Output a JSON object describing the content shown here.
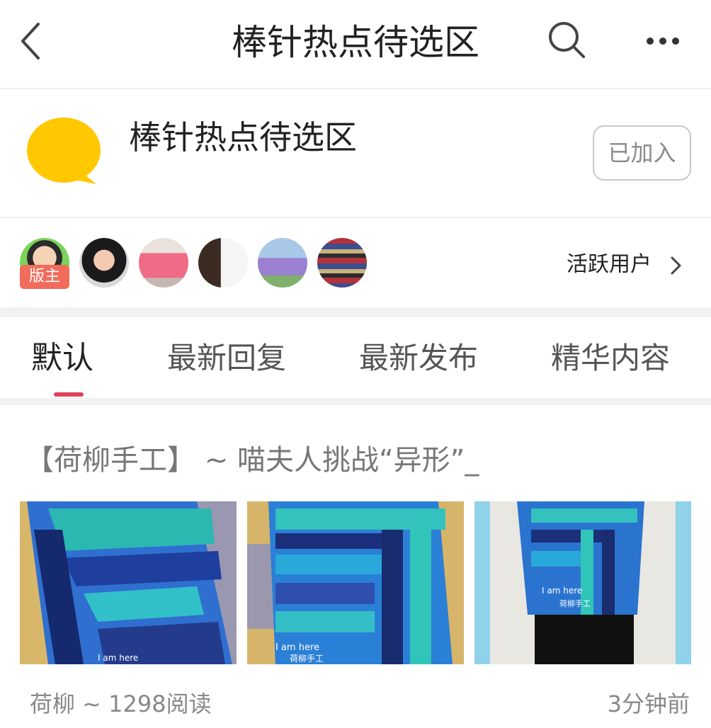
{
  "header": {
    "title": "棒针热点待选区",
    "back_icon": "chevron-left-icon",
    "search_icon": "search-icon",
    "more_icon": "more-dots-icon"
  },
  "group": {
    "name": "棒针热点待选区",
    "logo_color": "#FFC800",
    "join_label": "已加入"
  },
  "active_users": {
    "owner_badge": "版主",
    "link_label": "活跃用户",
    "badge_color": "#F26B5B"
  },
  "tabs": [
    {
      "label": "默认",
      "active": true
    },
    {
      "label": "最新回复",
      "active": false
    },
    {
      "label": "最新发布",
      "active": false
    },
    {
      "label": "精华内容",
      "active": false
    }
  ],
  "accent_color": "#E0405A",
  "post": {
    "title": "【荷柳手工】 ~ 喵夫人挑战“异形”_",
    "images": [
      {
        "watermark": "I am here"
      },
      {
        "watermark": "I am here",
        "caption": "荷柳手工"
      },
      {
        "watermark": "I am here",
        "caption": "荷柳手工"
      }
    ],
    "meta": "荷柳 ~ 1298阅读",
    "time": "3分钟前"
  }
}
